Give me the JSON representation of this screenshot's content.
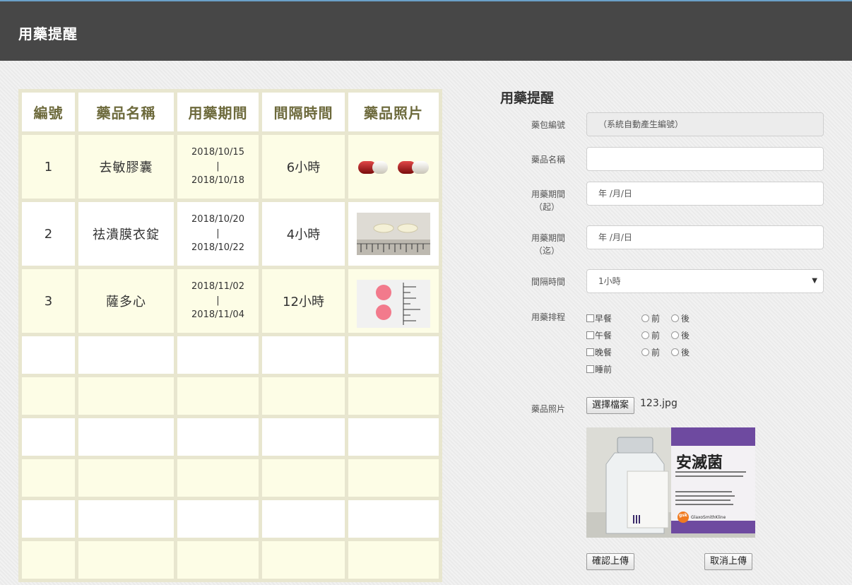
{
  "app": {
    "title": "用藥提醒"
  },
  "table": {
    "headers": [
      "編號",
      "藥品名稱",
      "用藥期間",
      "間隔時間",
      "藥品照片"
    ],
    "rows": [
      {
        "id": "1",
        "name": "去敏膠囊",
        "start": "2018/10/15",
        "sep": "|",
        "end": "2018/10/18",
        "interval": "6小時",
        "photo": "capsule-photo"
      },
      {
        "id": "2",
        "name": "祛潰膜衣錠",
        "start": "2018/10/20",
        "sep": "|",
        "end": "2018/10/22",
        "interval": "4小時",
        "photo": "tablet-photo"
      },
      {
        "id": "3",
        "name": "薩多心",
        "start": "2018/11/02",
        "sep": "|",
        "end": "2018/11/04",
        "interval": "12小時",
        "photo": "pink-pill-photo"
      }
    ],
    "empty_rows": 6
  },
  "form": {
    "title": "用藥提醒",
    "pack_id_label": "藥包編號",
    "pack_id_value": "（系統自動產生編號）",
    "drug_name_label": "藥品名稱",
    "drug_name_value": "",
    "start_label": "用藥期間",
    "start_sub": "（起）",
    "start_value": "年 /月/日",
    "end_label": "用藥期間",
    "end_sub": "（迄）",
    "end_value": "年 /月/日",
    "interval_label": "間隔時間",
    "interval_value": "1小時",
    "schedule_label": "用藥排程",
    "schedule": [
      {
        "meal": "早餐",
        "before": "前",
        "after": "後"
      },
      {
        "meal": "午餐",
        "before": "前",
        "after": "後"
      },
      {
        "meal": "晚餐",
        "before": "前",
        "after": "後"
      },
      {
        "meal": "睡前"
      }
    ],
    "photo_label": "藥品照片",
    "choose_file": "選擇檔案",
    "file_name": "123.jpg",
    "preview": {
      "box_title": "安滅菌",
      "brand": "GlaxoSmithKline",
      "brand_short": "gsk"
    },
    "confirm": "確認上傳",
    "cancel": "取消上傳"
  },
  "colors": {
    "header_bg": "#474747",
    "table_frame": "#e8e6cf",
    "header_text": "#6d6a3c",
    "odd_row": "#fdfde6"
  }
}
